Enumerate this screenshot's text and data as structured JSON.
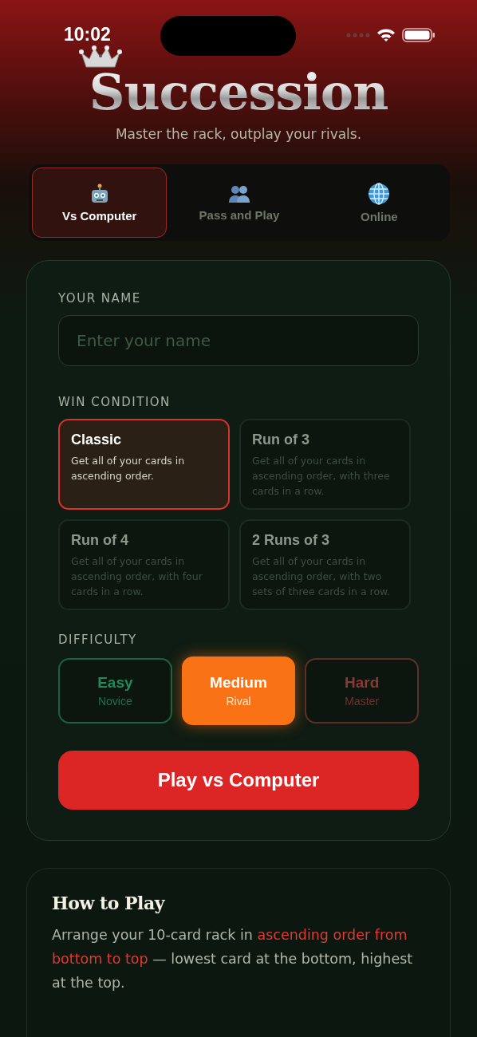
{
  "status_bar": {
    "time": "10:02"
  },
  "header": {
    "title": "Succession",
    "subtitle": "Master the rack, outplay your rivals."
  },
  "tabs": [
    {
      "label": "Vs Computer",
      "selected": true
    },
    {
      "label": "Pass and Play",
      "selected": false
    },
    {
      "label": "Online",
      "selected": false
    }
  ],
  "setup": {
    "name_label": "YOUR NAME",
    "name_field": {
      "placeholder": "Enter your name"
    },
    "win_label": "WIN CONDITION",
    "win_conditions": [
      {
        "title": "Classic",
        "description": "Get all of your cards in ascending order.",
        "selected": true
      },
      {
        "title": "Run of 3",
        "description": "Get all of your cards in ascending order, with three cards in a row.",
        "selected": false
      },
      {
        "title": "Run of 4",
        "description": "Get all of your cards in ascending order, with four cards in a row.",
        "selected": false
      },
      {
        "title": "2 Runs of 3",
        "description": "Get all of your cards in ascending order, with two sets of three cards in a row.",
        "selected": false
      }
    ],
    "difficulty_label": "DIFFICULTY",
    "difficulties": [
      {
        "label": "Easy",
        "sublabel": "Novice",
        "color": "#1f8a5b",
        "selected": false
      },
      {
        "label": "Medium",
        "sublabel": "Rival",
        "color": "#f97316",
        "selected": true
      },
      {
        "label": "Hard",
        "sublabel": "Master",
        "color": "#8a3a36",
        "selected": false
      }
    ],
    "play_button": "Play vs Computer"
  },
  "how_to_play": {
    "title": "How to Play",
    "paragraph": [
      {
        "text": "Arrange your 10-card rack in ",
        "highlight": false
      },
      {
        "text": "ascending order from bottom to top",
        "highlight": true
      },
      {
        "text": " — lowest card at the bottom, highest at the top.",
        "highlight": false
      }
    ]
  }
}
